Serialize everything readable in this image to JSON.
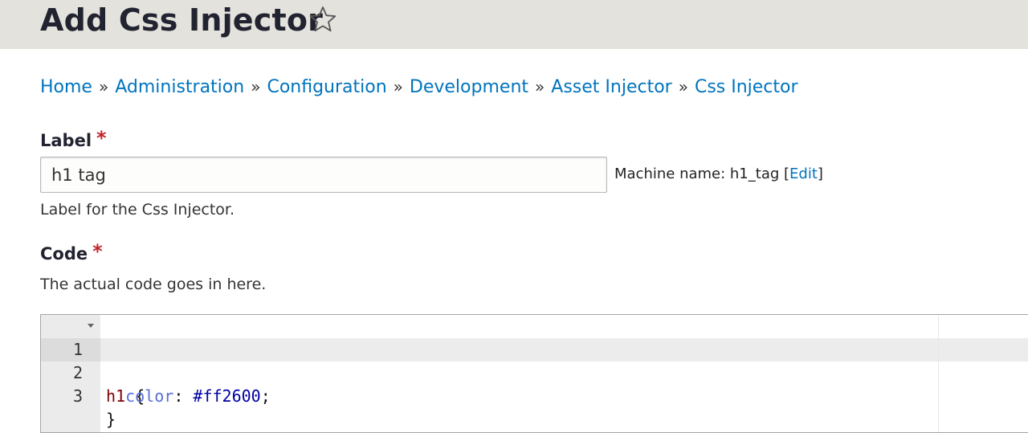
{
  "header": {
    "title": "Add Css Injector",
    "favorite_icon": "star-outline-icon"
  },
  "breadcrumb": {
    "items": [
      "Home",
      "Administration",
      "Configuration",
      "Development",
      "Asset Injector",
      "Css Injector"
    ],
    "separator": "»"
  },
  "label_field": {
    "label": "Label",
    "required_marker": "*",
    "value": "h1 tag",
    "machine_name_prefix": "Machine name: h1_tag [",
    "machine_name_edit": "Edit",
    "machine_name_suffix": "]",
    "description": "Label for the Css Injector."
  },
  "code_field": {
    "label": "Code",
    "required_marker": "*",
    "description": "The actual code goes in here."
  },
  "editor": {
    "lines": [
      {
        "number": "1",
        "selector": "h1",
        "brace": " {"
      },
      {
        "number": "2",
        "indent": "  ",
        "property": "color",
        "colon": ": ",
        "value": "#ff2600",
        "semicolon": ";"
      },
      {
        "number": "3",
        "brace": "}"
      }
    ],
    "active_line": 2
  },
  "colors": {
    "header_bg": "#e3e2dc",
    "link": "#0074bd",
    "required": "#c0262c"
  }
}
